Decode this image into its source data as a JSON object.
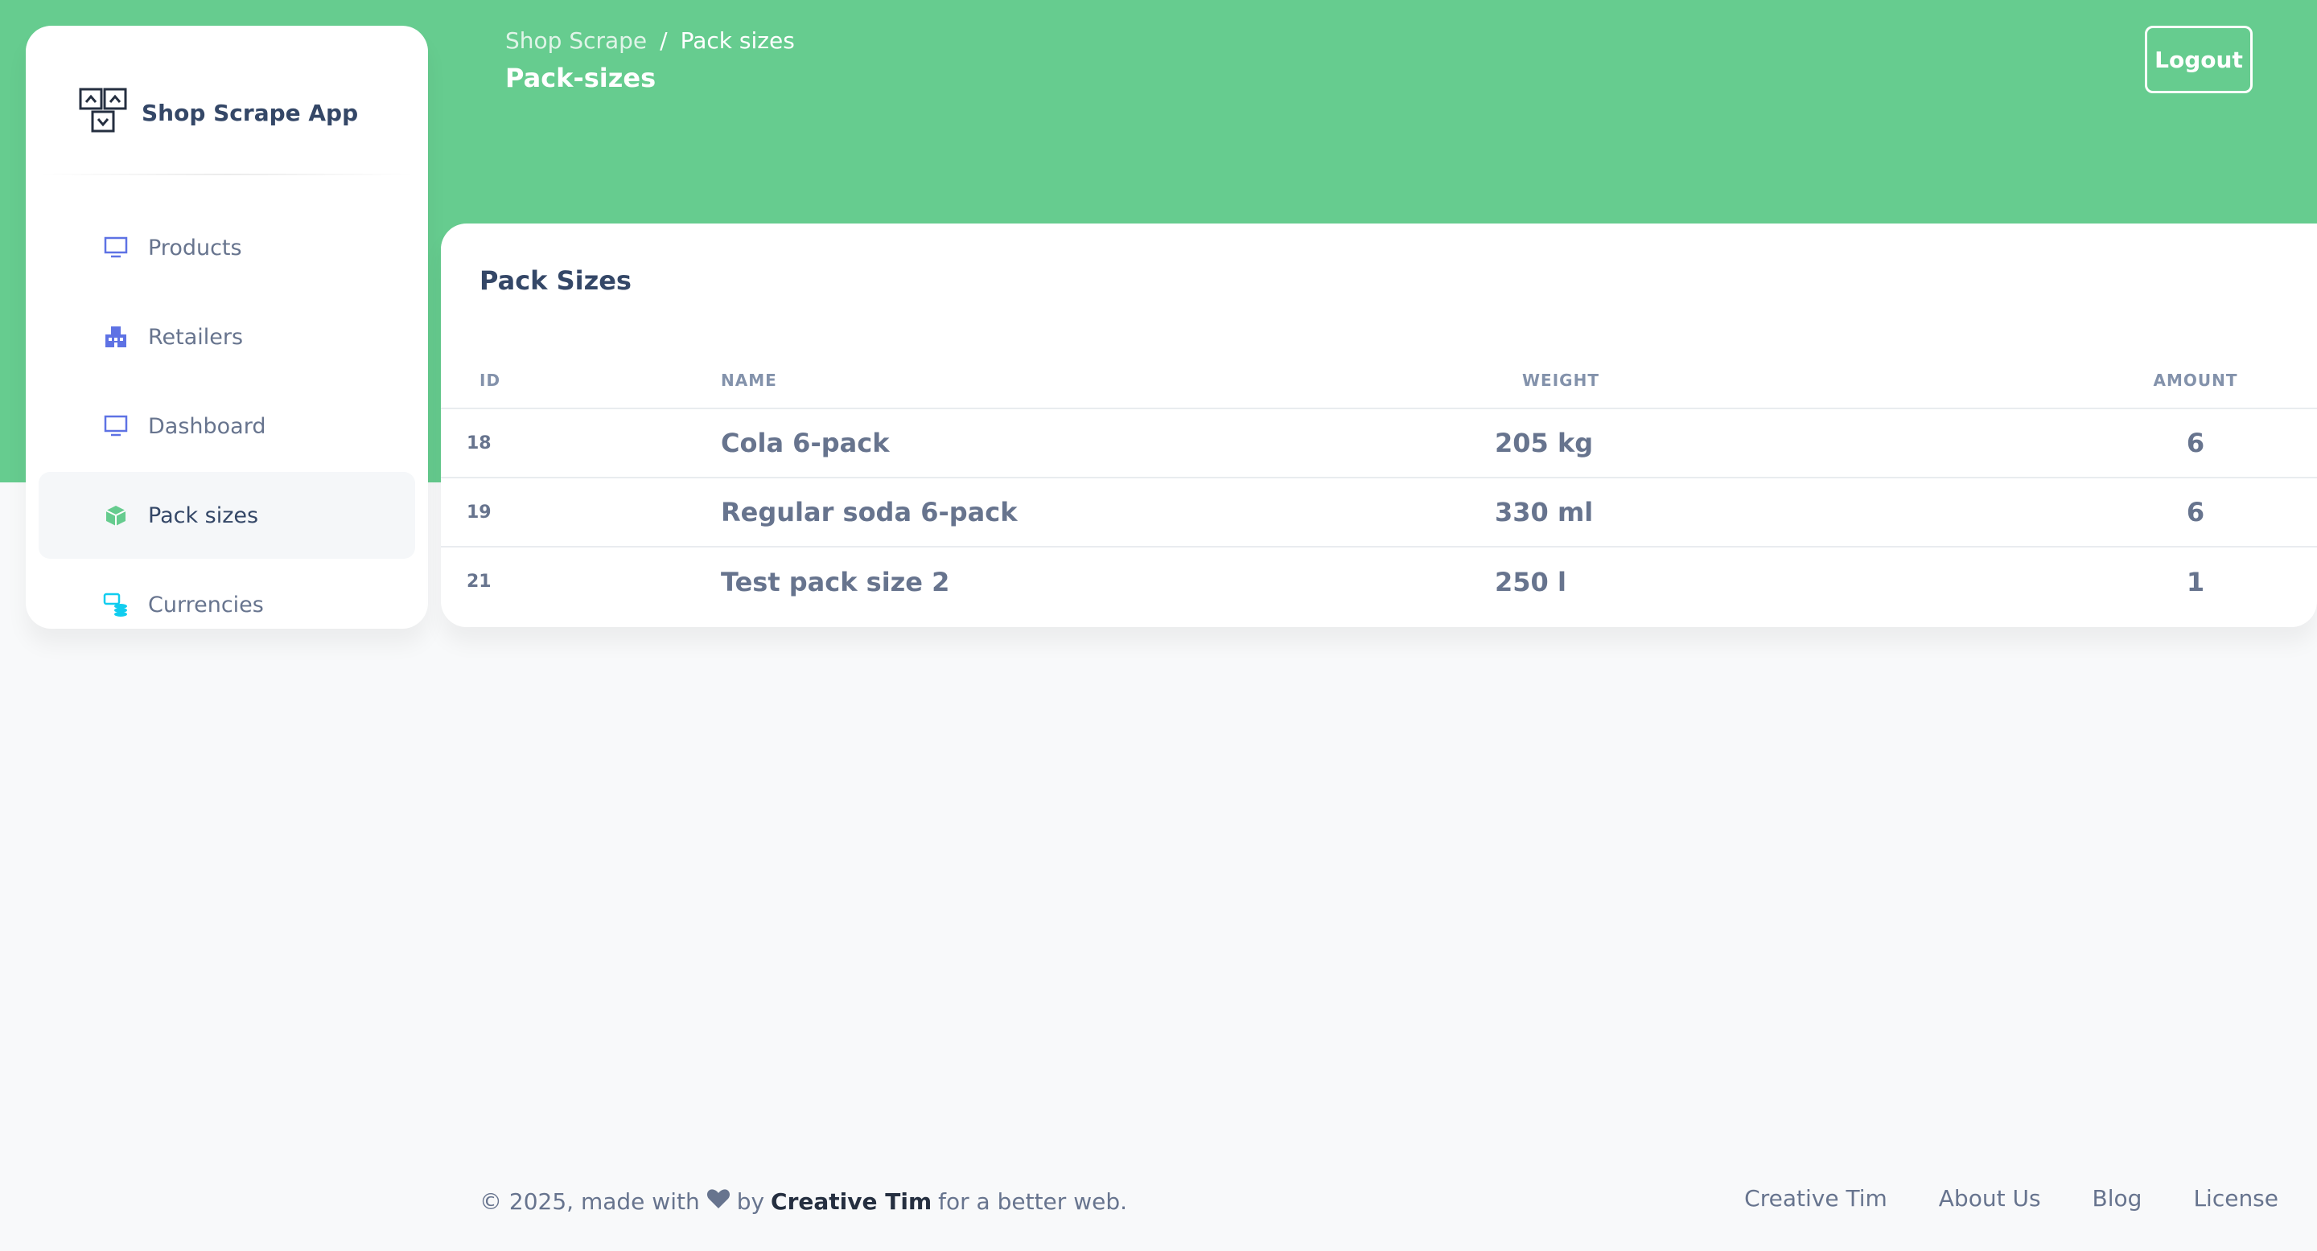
{
  "brand": {
    "name": "Shop Scrape App",
    "icon": "sitemap-icon"
  },
  "sidebar": {
    "items": [
      {
        "label": "Products",
        "icon": "monitor-icon",
        "active": false
      },
      {
        "label": "Retailers",
        "icon": "building-icon",
        "active": false
      },
      {
        "label": "Dashboard",
        "icon": "monitor-icon",
        "active": false
      },
      {
        "label": "Pack sizes",
        "icon": "box-icon",
        "active": true
      },
      {
        "label": "Currencies",
        "icon": "coins-icon",
        "active": false
      }
    ]
  },
  "header": {
    "breadcrumb": {
      "root": "Shop Scrape",
      "separator": "/",
      "current": "Pack sizes"
    },
    "title": "Pack-sizes",
    "logout_label": "Logout"
  },
  "card": {
    "title": "Pack Sizes",
    "columns": [
      "ID",
      "NAME",
      "WEIGHT",
      "AMOUNT"
    ],
    "rows": [
      {
        "id": "18",
        "name": "Cola 6-pack",
        "weight": "205 kg",
        "amount": "6"
      },
      {
        "id": "19",
        "name": "Regular soda 6-pack",
        "weight": "330 ml",
        "amount": "6"
      },
      {
        "id": "21",
        "name": "Test pack size 2",
        "weight": "250 l",
        "amount": "1"
      }
    ]
  },
  "footer": {
    "prefix": "© 2025, made with",
    "heart_icon": "heart-icon",
    "by": "by",
    "author": "Creative Tim",
    "suffix": "for a better web.",
    "links": [
      "Creative Tim",
      "About Us",
      "Blog",
      "License"
    ]
  },
  "colors": {
    "accent": "#66cc8f",
    "background": "#f8f9fa",
    "text": "#67748e",
    "heading": "#344767"
  }
}
